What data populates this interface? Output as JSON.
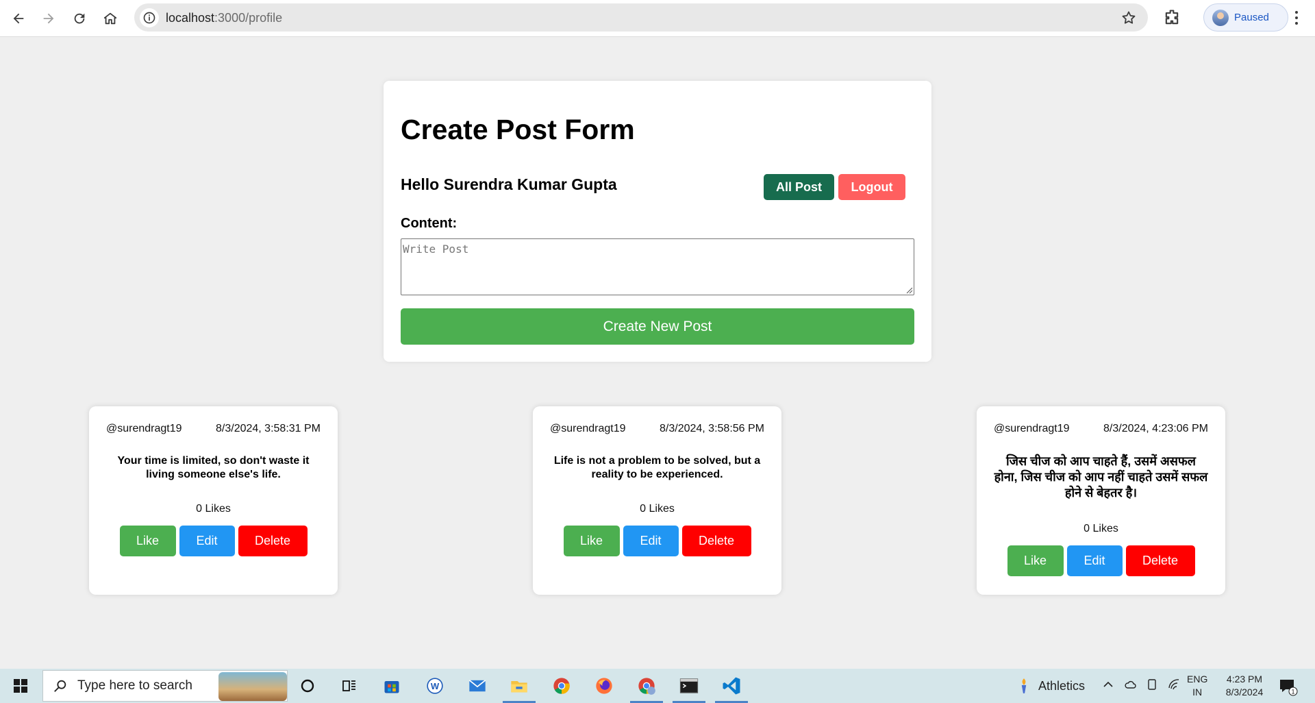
{
  "browser": {
    "url_host": "localhost",
    "url_path": ":3000/profile",
    "profile_status": "Paused"
  },
  "form": {
    "title": "Create Post Form",
    "greeting": "Hello Surendra Kumar Gupta",
    "all_post_label": "All Post",
    "logout_label": "Logout",
    "content_label": "Content:",
    "content_placeholder": "Write Post",
    "content_value": "",
    "submit_label": "Create New Post"
  },
  "posts": [
    {
      "username": "@surendragt19",
      "timestamp": "8/3/2024, 3:58:31 PM",
      "content": "Your time is limited, so don't waste it living someone else's life.",
      "likes": "0 Likes",
      "like_label": "Like",
      "edit_label": "Edit",
      "delete_label": "Delete"
    },
    {
      "username": "@surendragt19",
      "timestamp": "8/3/2024, 3:58:56 PM",
      "content": "Life is not a problem to be solved, but a reality to be experienced.",
      "likes": "0 Likes",
      "like_label": "Like",
      "edit_label": "Edit",
      "delete_label": "Delete"
    },
    {
      "username": "@surendragt19",
      "timestamp": "8/3/2024, 4:23:06 PM",
      "content": "जिस चीज को आप चाहते हैं, उसमें असफल होना, जिस चीज को आप नहीं चाहते उसमें सफल होने से बेहतर है।",
      "likes": "0 Likes",
      "like_label": "Like",
      "edit_label": "Edit",
      "delete_label": "Delete"
    }
  ],
  "taskbar": {
    "search_placeholder": "Type here to search",
    "weather_text": "Athletics",
    "lang_top": "ENG",
    "lang_bottom": "IN",
    "time": "4:23 PM",
    "date": "8/3/2024",
    "notification_count": "1"
  },
  "colors": {
    "all_post": "#176c4e",
    "logout": "#ff5f5f",
    "create": "#4caf50",
    "like": "#4caf50",
    "edit": "#2196f3",
    "delete": "#ff0000"
  }
}
